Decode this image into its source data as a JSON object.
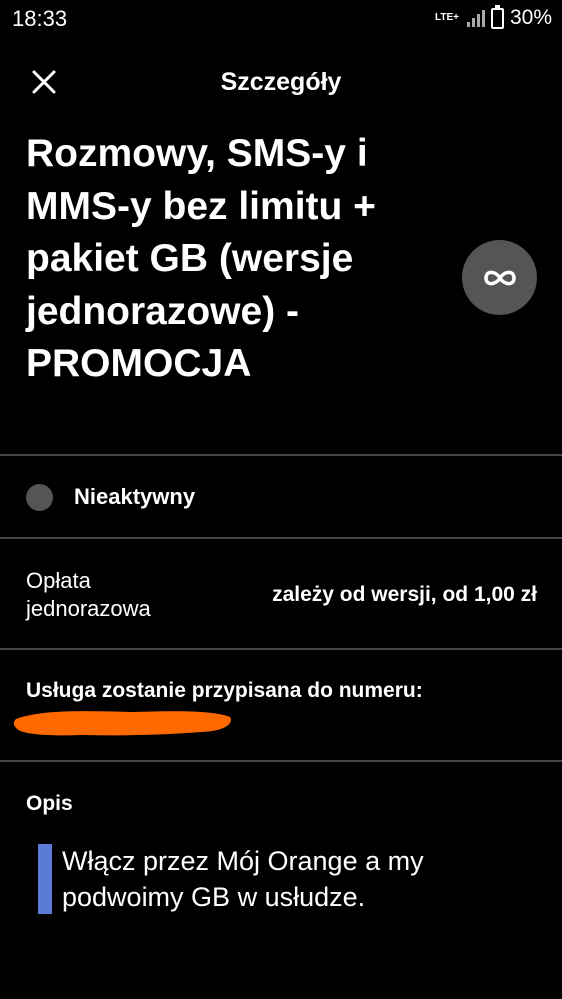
{
  "status_bar": {
    "time": "18:33",
    "network": "LTE+",
    "battery": "30%"
  },
  "header": {
    "title": "Szczegóły"
  },
  "product": {
    "title": "Rozmowy, SMS-y i MMS-y bez limitu + pakiet GB (wersje jednorazowe) - PROMOCJA",
    "icon": "infinity-icon"
  },
  "status": {
    "label": "Nieaktywny"
  },
  "fee": {
    "label": "Opłata jednorazowa",
    "value": "zależy od wersji, od 1,00 zł"
  },
  "assignment": {
    "label": "Usługa zostanie przypisana do numeru:"
  },
  "description": {
    "heading": "Opis",
    "text": "Włącz przez Mój Orange a my podwoimy GB w usłudze."
  },
  "colors": {
    "background": "#000000",
    "accent_bar": "#5b7bd5",
    "redaction": "#ff6a00",
    "icon_circle": "#555555"
  }
}
